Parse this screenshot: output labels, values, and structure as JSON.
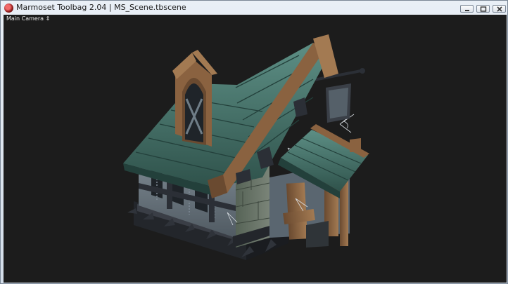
{
  "window": {
    "title": "Marmoset Toolbag 2.04  |  MS_Scene.tbscene",
    "app_icon": "marmoset-logo-icon",
    "controls": [
      "minimize-icon",
      "maximize-icon",
      "close-icon"
    ]
  },
  "viewport": {
    "camera_label": "Main Camera ⇕",
    "background_color": "#1c1c1c",
    "scene_object": "stylized-house-model"
  },
  "colors": {
    "roof": "#3f6e64",
    "roof_dark": "#23403b",
    "wood": "#8a6240",
    "wall": "#6a7680",
    "stone": "#5d6b60",
    "iron": "#2b2f36"
  }
}
